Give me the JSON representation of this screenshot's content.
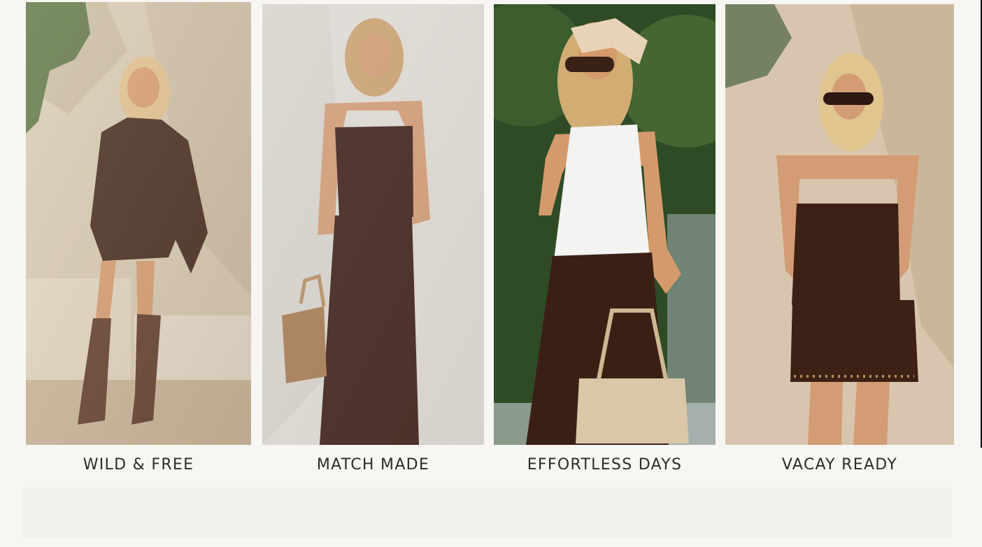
{
  "collections": [
    {
      "title": "WILD & FREE",
      "image_alt": "Woman in brown fringe suede jacket and tall brown western boots standing by stone steps",
      "colors": {
        "wall": "#d8cbb5",
        "shadow": "#b9a88d",
        "outfit": "#3c2118",
        "skin": "#d79b6f",
        "hair": "#e2c28f",
        "ground": "#c9b79c"
      }
    },
    {
      "title": "MATCH MADE",
      "image_alt": "Woman in matching brown lace camisole and wide-leg trousers holding a tan leather bag",
      "colors": {
        "wall": "#dedad4",
        "shadow": "#c8c2ba",
        "outfit": "#3b1e16",
        "skin": "#d29a74",
        "hair": "#c9a06e",
        "accent": "#a57a52"
      }
    },
    {
      "title": "EFFORTLESS DAYS",
      "image_alt": "Woman in white tank top, brown pants, headscarf and sunglasses holding a beige handbag in front of greenery",
      "colors": {
        "background": "#2e4b25",
        "foliage": "#40622f",
        "top": "#f3f3f1",
        "outfit": "#3b1f15",
        "skin": "#d59a6b",
        "hair": "#d1ad73",
        "accent": "#d9c7a7"
      }
    },
    {
      "title": "VACAY READY",
      "image_alt": "Woman in brown lace camisole and studded mini skirt wearing sunglasses against a sunlit wall",
      "colors": {
        "wall": "#d7c6ad",
        "shadow": "#b7a184",
        "outfit": "#3d2117",
        "skin": "#d39c74",
        "hair": "#e1c58f",
        "accent": "#b78e55"
      }
    }
  ],
  "footer_band": {
    "text": ""
  }
}
